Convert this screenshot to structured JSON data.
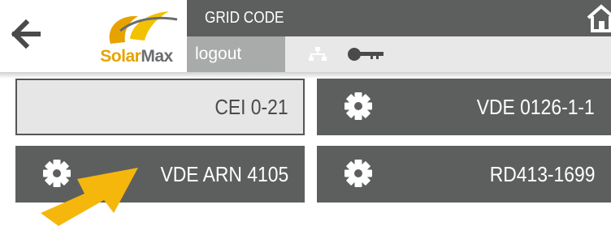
{
  "header": {
    "title": "GRID CODE",
    "logout_label": "logout",
    "logo": {
      "brand_part1": "Solar",
      "brand_part2": "Max",
      "accent": "#e6a300"
    }
  },
  "grid_codes": [
    {
      "label": "CEI 0-21",
      "selected": true,
      "icon": null
    },
    {
      "label": "VDE 0126-1-1",
      "selected": false,
      "icon": "gear-icon"
    },
    {
      "label": "VDE ARN 4105",
      "selected": false,
      "icon": "gear-icon"
    },
    {
      "label": "RD413-1699",
      "selected": false,
      "icon": "gear-icon"
    }
  ],
  "icons": [
    "back-arrow-icon",
    "home-icon",
    "network-icon",
    "key-icon",
    "gear-icon",
    "pointer-arrow-icon"
  ],
  "colors": {
    "dark": "#5d5f5f",
    "light": "#e6e6e6",
    "logout_bg": "#a9abab",
    "arrow": "#f5b70c"
  }
}
